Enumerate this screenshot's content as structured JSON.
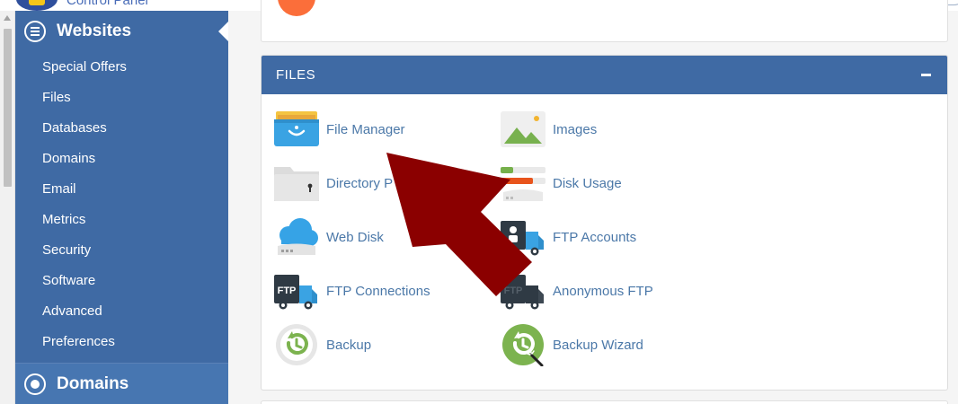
{
  "brand": {
    "text": "Control Panel"
  },
  "sidebar": {
    "group_title": "Websites",
    "items": [
      {
        "label": "Special Offers"
      },
      {
        "label": "Files"
      },
      {
        "label": "Databases"
      },
      {
        "label": "Domains"
      },
      {
        "label": "Email"
      },
      {
        "label": "Metrics"
      },
      {
        "label": "Security"
      },
      {
        "label": "Software"
      },
      {
        "label": "Advanced"
      },
      {
        "label": "Preferences"
      }
    ],
    "next_group_title": "Domains"
  },
  "files_panel": {
    "title": "FILES",
    "apps": [
      {
        "label": "File Manager",
        "icon": "file-manager-icon"
      },
      {
        "label": "Images",
        "icon": "images-icon"
      },
      {
        "label": "Directory P",
        "icon": "directory-privacy-icon"
      },
      {
        "label": "Disk Usage",
        "icon": "disk-usage-icon"
      },
      {
        "label": "Web Disk",
        "icon": "web-disk-icon"
      },
      {
        "label": "FTP Accounts",
        "icon": "ftp-accounts-icon"
      },
      {
        "label": "FTP Connections",
        "icon": "ftp-connections-icon"
      },
      {
        "label": "Anonymous FTP",
        "icon": "anonymous-ftp-icon"
      },
      {
        "label": "Backup",
        "icon": "backup-icon"
      },
      {
        "label": "Backup Wizard",
        "icon": "backup-wizard-icon"
      }
    ]
  },
  "icon_text": {
    "ftp": "FTP"
  },
  "colors": {
    "sidebar": "#3f6aa4",
    "link": "#4b78a8",
    "arrow": "#8b0000",
    "backup_green": "#7cb34f"
  }
}
